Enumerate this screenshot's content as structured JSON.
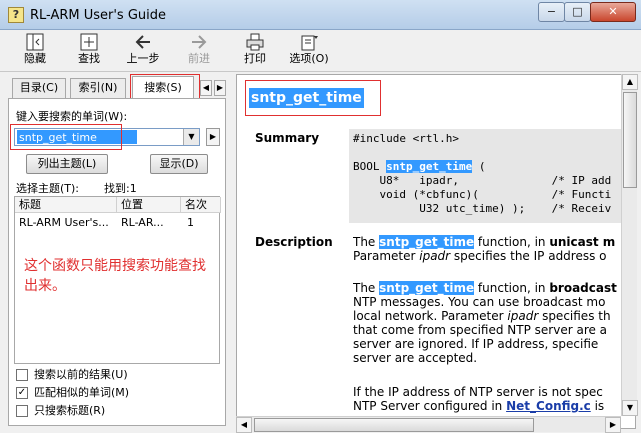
{
  "window": {
    "title": "RL-ARM User's Guide",
    "app_icon": "?",
    "minimize": "−",
    "maximize": "□",
    "close": "✕"
  },
  "toolbar": {
    "hide": "隐藏",
    "locate": "查找",
    "back": "上一步",
    "forward": "前进",
    "print": "打印",
    "options": "选项(O)",
    "icons": {
      "hide": "hide-pane-icon",
      "locate": "locate-icon",
      "back": "back-arrow-icon",
      "forward": "forward-arrow-icon",
      "print": "printer-icon",
      "options": "options-icon"
    }
  },
  "left": {
    "tabs": [
      {
        "label": "目录(C)"
      },
      {
        "label": "索引(N)"
      },
      {
        "label": "搜索(S)"
      }
    ],
    "keyword_label": "键入要搜索的单词(W):",
    "search_value": "sntp_get_time",
    "list_topics_button": "列出主题(L)",
    "display_button": "显示(D)",
    "select_topic_label": "选择主题(T):",
    "found_label": "找到:1",
    "columns": [
      "标题",
      "位置",
      "名次"
    ],
    "rows": [
      {
        "title": "RL-ARM User's...",
        "location": "RL-AR...",
        "rank": "1"
      }
    ],
    "annotation": "这个函数只能用搜索功能查找出来。",
    "checkboxes": [
      {
        "label": "搜索以前的结果(U)",
        "checked": false
      },
      {
        "label": "匹配相似的单词(M)",
        "checked": true
      },
      {
        "label": "只搜索标题(R)",
        "checked": false
      }
    ]
  },
  "content": {
    "heading": "sntp_get_time",
    "summary_title": "Summary",
    "code_lines": [
      "#include <rtl.h>",
      "",
      "BOOL ",
      "    U8*   ipadr,              /* IP add",
      "    void (*cbfunc)(           /* Functi",
      "          U32 utc_time) );    /* Receiv"
    ],
    "code_func": "sntp_get_time",
    "code_paren": " (",
    "cbfunc": "cbfunc",
    "description_title": "Description",
    "desc1": {
      "pre": "The ",
      "func": "sntp_get_time",
      "mid": " function, in ",
      "bold": "unicast m",
      "line2_pre": "Parameter ",
      "ipadr": "ipadr",
      "line2_post": " specifies the IP address o"
    },
    "desc2": {
      "pre": "The ",
      "func": "sntp_get_time",
      "mid": " function, in ",
      "bold": "broadcast",
      "lines": [
        "NTP messages. You can use broadcast mo",
        "local network. Parameter ",
        "that come from specified NTP server are a",
        "server are ignored. If IP address, specifie",
        "server are accepted."
      ],
      "ipadr": "ipadr",
      "line3_post": " specifies th"
    },
    "desc3": {
      "line1": "If the IP address of NTP server is not spec",
      "line2_pre": "NTP Server configured in ",
      "link": "Net_Config.c",
      "line2_post": " is"
    }
  }
}
